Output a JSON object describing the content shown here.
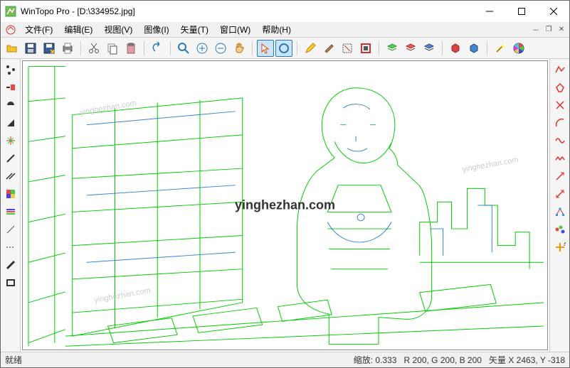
{
  "title": "WinTopo Pro - [D:\\334952.jpg]",
  "menu": {
    "file": "文件(F)",
    "edit": "编辑(E)",
    "view": "视图(V)",
    "image": "图像(I)",
    "vector": "矢量(T)",
    "window": "窗口(W)",
    "help": "帮助(H)"
  },
  "status": {
    "ready": "就绪",
    "zoom_label": "缩放:",
    "zoom": "0.333",
    "r_label": "R",
    "r": "200",
    "g_label": "G",
    "g": "200",
    "b_label": "B",
    "b": "200",
    "vec_label": "矢量",
    "x_label": "X",
    "x": "2463",
    "y_label": "Y",
    "y": "-318"
  },
  "watermark": "yinghezhan.com"
}
